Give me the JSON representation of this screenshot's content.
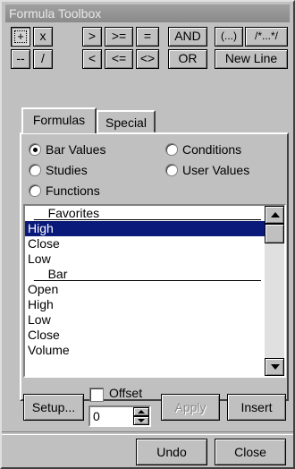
{
  "window": {
    "title": "Formula Toolbox"
  },
  "operators": {
    "row1": [
      "+",
      "x",
      ">",
      ">=",
      "=",
      "AND",
      "(...)",
      "/*...*/"
    ],
    "row2": [
      "--",
      "/",
      "<",
      "<=",
      "<>",
      "OR",
      "New Line"
    ]
  },
  "tabs": [
    {
      "label": "Formulas",
      "active": true
    },
    {
      "label": "Special",
      "active": false
    }
  ],
  "radios": [
    {
      "label": "Bar Values",
      "checked": true
    },
    {
      "label": "Conditions",
      "checked": false
    },
    {
      "label": "Studies",
      "checked": false
    },
    {
      "label": "User Values",
      "checked": false
    },
    {
      "label": "Functions",
      "checked": false
    }
  ],
  "list": {
    "items": [
      {
        "label": "__Favorites__",
        "group": true
      },
      {
        "label": "High",
        "selected": true
      },
      {
        "label": "Close"
      },
      {
        "label": "Low"
      },
      {
        "label": "__Bar__",
        "group": true
      },
      {
        "label": "Open"
      },
      {
        "label": "High"
      },
      {
        "label": "Low"
      },
      {
        "label": "Close"
      },
      {
        "label": "Volume"
      }
    ]
  },
  "controls": {
    "setup_label": "Setup...",
    "offset_label": "Offset",
    "offset_value": "0",
    "apply_label": "Apply",
    "insert_label": "Insert",
    "undo_label": "Undo",
    "close_label": "Close"
  }
}
